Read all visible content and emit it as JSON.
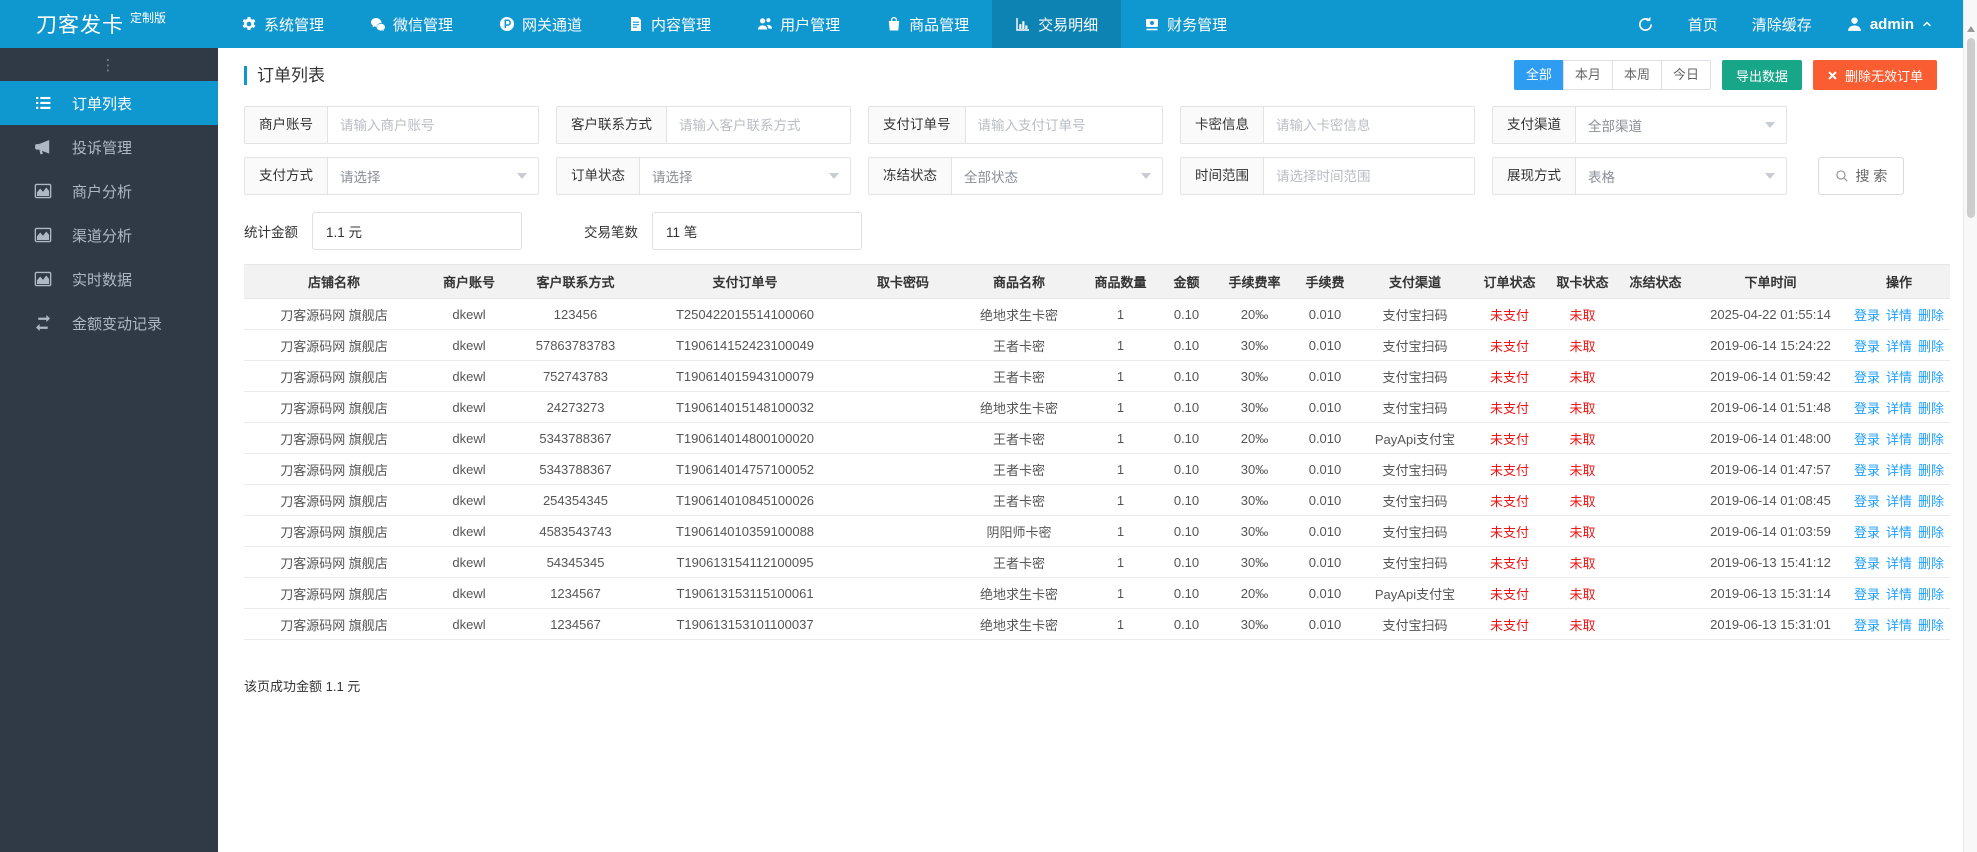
{
  "colors": {
    "topbar_blue": "#0f97d0",
    "topbar_active": "#0d83b4",
    "sidebar_dark": "#303a46",
    "tab_active_blue": "#2e9cf0",
    "export_teal": "#18a689",
    "delete_orange": "#f95d31",
    "status_red": "#f01414",
    "link_blue": "#1e9fff"
  },
  "topbar": {
    "logo": "刀客发卡",
    "logo_badge": "定制版",
    "nav_items": [
      {
        "key": "system-management",
        "label": "系统管理",
        "icon": "gear-icon",
        "active": false
      },
      {
        "key": "wechat-management",
        "label": "微信管理",
        "icon": "wechat-icon",
        "active": false
      },
      {
        "key": "gateway-channel",
        "label": "网关通道",
        "icon": "gateway-p-icon",
        "active": false
      },
      {
        "key": "content-management",
        "label": "内容管理",
        "icon": "document-icon",
        "active": false
      },
      {
        "key": "user-management",
        "label": "用户管理",
        "icon": "users-icon",
        "active": false
      },
      {
        "key": "goods-management",
        "label": "商品管理",
        "icon": "shopping-bag-icon",
        "active": false
      },
      {
        "key": "trade-detail",
        "label": "交易明细",
        "icon": "bar-chart-icon",
        "active": true
      },
      {
        "key": "finance-management",
        "label": "财务管理",
        "icon": "banknote-icon",
        "active": false
      }
    ],
    "home_label": "首页",
    "clear_cache_label": "清除缓存",
    "username": "admin"
  },
  "sidebar": {
    "items": [
      {
        "key": "order-list",
        "label": "订单列表",
        "icon": "ordered-list-icon",
        "active": true
      },
      {
        "key": "complaint-management",
        "label": "投诉管理",
        "icon": "megaphone-icon",
        "active": false
      },
      {
        "key": "merchant-analysis",
        "label": "商户分析",
        "icon": "area-chart-icon",
        "active": false
      },
      {
        "key": "channel-analysis",
        "label": "渠道分析",
        "icon": "area-chart-icon",
        "active": false
      },
      {
        "key": "realtime-data",
        "label": "实时数据",
        "icon": "area-chart-icon",
        "active": false
      },
      {
        "key": "balance-change-log",
        "label": "金额变动记录",
        "icon": "exchange-icon",
        "active": false
      }
    ]
  },
  "page": {
    "title": "订单列表",
    "range_tabs": [
      {
        "label": "全部",
        "active": true
      },
      {
        "label": "本月",
        "active": false
      },
      {
        "label": "本周",
        "active": false
      },
      {
        "label": "今日",
        "active": false
      }
    ],
    "export_label": "导出数据",
    "delete_invalid_label": "删除无效订单",
    "footer_summary": "该页成功金额 1.1 元"
  },
  "filters": {
    "row1": [
      {
        "key": "merchant-account",
        "label": "商户账号",
        "type": "text",
        "placeholder": "请输入商户账号"
      },
      {
        "key": "customer-contact",
        "label": "客户联系方式",
        "type": "text",
        "placeholder": "请输入客户联系方式"
      },
      {
        "key": "payment-order-no",
        "label": "支付订单号",
        "type": "text",
        "placeholder": "请输入支付订单号"
      },
      {
        "key": "card-info",
        "label": "卡密信息",
        "type": "text",
        "placeholder": "请输入卡密信息"
      },
      {
        "key": "payment-channel",
        "label": "支付渠道",
        "type": "select",
        "value": "全部渠道"
      }
    ],
    "row2": [
      {
        "key": "payment-method",
        "label": "支付方式",
        "type": "select",
        "value": "请选择"
      },
      {
        "key": "order-status",
        "label": "订单状态",
        "type": "select",
        "value": "请选择"
      },
      {
        "key": "freeze-status",
        "label": "冻结状态",
        "type": "select",
        "value": "全部状态"
      },
      {
        "key": "time-range",
        "label": "时间范围",
        "type": "text",
        "placeholder": "请选择时间范围"
      },
      {
        "key": "display-mode",
        "label": "展现方式",
        "type": "select",
        "value": "表格"
      }
    ],
    "search_label": "搜 索"
  },
  "stats": {
    "amount_label": "统计金额",
    "amount_value": "1.1 元",
    "count_label": "交易笔数",
    "count_value": "11 笔"
  },
  "table": {
    "headers": [
      "店铺名称",
      "商户账号",
      "客户联系方式",
      "支付订单号",
      "取卡密码",
      "商品名称",
      "商品数量",
      "金额",
      "手续费率",
      "手续费",
      "支付渠道",
      "订单状态",
      "取卡状态",
      "冻结状态",
      "下单时间",
      "操作"
    ],
    "action_labels": [
      "登录",
      "详情",
      "删除"
    ],
    "rows": [
      {
        "shop": "刀客源码网 旗舰店",
        "account": "dkewl",
        "contact": "123456",
        "order_no": "T250422015514100060",
        "card_pwd": "",
        "product": "绝地求生卡密",
        "qty": "1",
        "amount": "0.10",
        "fee_rate": "20‰",
        "fee": "0.010",
        "channel": "支付宝扫码",
        "order_status": "未支付",
        "card_status": "未取",
        "freeze_status": "",
        "time": "2025-04-22 01:55:14"
      },
      {
        "shop": "刀客源码网 旗舰店",
        "account": "dkewl",
        "contact": "57863783783",
        "order_no": "T190614152423100049",
        "card_pwd": "",
        "product": "王者卡密",
        "qty": "1",
        "amount": "0.10",
        "fee_rate": "30‰",
        "fee": "0.010",
        "channel": "支付宝扫码",
        "order_status": "未支付",
        "card_status": "未取",
        "freeze_status": "",
        "time": "2019-06-14 15:24:22"
      },
      {
        "shop": "刀客源码网 旗舰店",
        "account": "dkewl",
        "contact": "752743783",
        "order_no": "T190614015943100079",
        "card_pwd": "",
        "product": "王者卡密",
        "qty": "1",
        "amount": "0.10",
        "fee_rate": "30‰",
        "fee": "0.010",
        "channel": "支付宝扫码",
        "order_status": "未支付",
        "card_status": "未取",
        "freeze_status": "",
        "time": "2019-06-14 01:59:42"
      },
      {
        "shop": "刀客源码网 旗舰店",
        "account": "dkewl",
        "contact": "24273273",
        "order_no": "T190614015148100032",
        "card_pwd": "",
        "product": "绝地求生卡密",
        "qty": "1",
        "amount": "0.10",
        "fee_rate": "30‰",
        "fee": "0.010",
        "channel": "支付宝扫码",
        "order_status": "未支付",
        "card_status": "未取",
        "freeze_status": "",
        "time": "2019-06-14 01:51:48"
      },
      {
        "shop": "刀客源码网 旗舰店",
        "account": "dkewl",
        "contact": "5343788367",
        "order_no": "T190614014800100020",
        "card_pwd": "",
        "product": "王者卡密",
        "qty": "1",
        "amount": "0.10",
        "fee_rate": "20‰",
        "fee": "0.010",
        "channel": "PayApi支付宝",
        "order_status": "未支付",
        "card_status": "未取",
        "freeze_status": "",
        "time": "2019-06-14 01:48:00"
      },
      {
        "shop": "刀客源码网 旗舰店",
        "account": "dkewl",
        "contact": "5343788367",
        "order_no": "T190614014757100052",
        "card_pwd": "",
        "product": "王者卡密",
        "qty": "1",
        "amount": "0.10",
        "fee_rate": "30‰",
        "fee": "0.010",
        "channel": "支付宝扫码",
        "order_status": "未支付",
        "card_status": "未取",
        "freeze_status": "",
        "time": "2019-06-14 01:47:57"
      },
      {
        "shop": "刀客源码网 旗舰店",
        "account": "dkewl",
        "contact": "254354345",
        "order_no": "T190614010845100026",
        "card_pwd": "",
        "product": "王者卡密",
        "qty": "1",
        "amount": "0.10",
        "fee_rate": "30‰",
        "fee": "0.010",
        "channel": "支付宝扫码",
        "order_status": "未支付",
        "card_status": "未取",
        "freeze_status": "",
        "time": "2019-06-14 01:08:45"
      },
      {
        "shop": "刀客源码网 旗舰店",
        "account": "dkewl",
        "contact": "4583543743",
        "order_no": "T190614010359100088",
        "card_pwd": "",
        "product": "阴阳师卡密",
        "qty": "1",
        "amount": "0.10",
        "fee_rate": "30‰",
        "fee": "0.010",
        "channel": "支付宝扫码",
        "order_status": "未支付",
        "card_status": "未取",
        "freeze_status": "",
        "time": "2019-06-14 01:03:59"
      },
      {
        "shop": "刀客源码网 旗舰店",
        "account": "dkewl",
        "contact": "54345345",
        "order_no": "T190613154112100095",
        "card_pwd": "",
        "product": "王者卡密",
        "qty": "1",
        "amount": "0.10",
        "fee_rate": "30‰",
        "fee": "0.010",
        "channel": "支付宝扫码",
        "order_status": "未支付",
        "card_status": "未取",
        "freeze_status": "",
        "time": "2019-06-13 15:41:12"
      },
      {
        "shop": "刀客源码网 旗舰店",
        "account": "dkewl",
        "contact": "1234567",
        "order_no": "T190613153115100061",
        "card_pwd": "",
        "product": "绝地求生卡密",
        "qty": "1",
        "amount": "0.10",
        "fee_rate": "20‰",
        "fee": "0.010",
        "channel": "PayApi支付宝",
        "order_status": "未支付",
        "card_status": "未取",
        "freeze_status": "",
        "time": "2019-06-13 15:31:14"
      },
      {
        "shop": "刀客源码网 旗舰店",
        "account": "dkewl",
        "contact": "1234567",
        "order_no": "T190613153101100037",
        "card_pwd": "",
        "product": "绝地求生卡密",
        "qty": "1",
        "amount": "0.10",
        "fee_rate": "30‰",
        "fee": "0.010",
        "channel": "支付宝扫码",
        "order_status": "未支付",
        "card_status": "未取",
        "freeze_status": "",
        "time": "2019-06-13 15:31:01"
      }
    ]
  }
}
